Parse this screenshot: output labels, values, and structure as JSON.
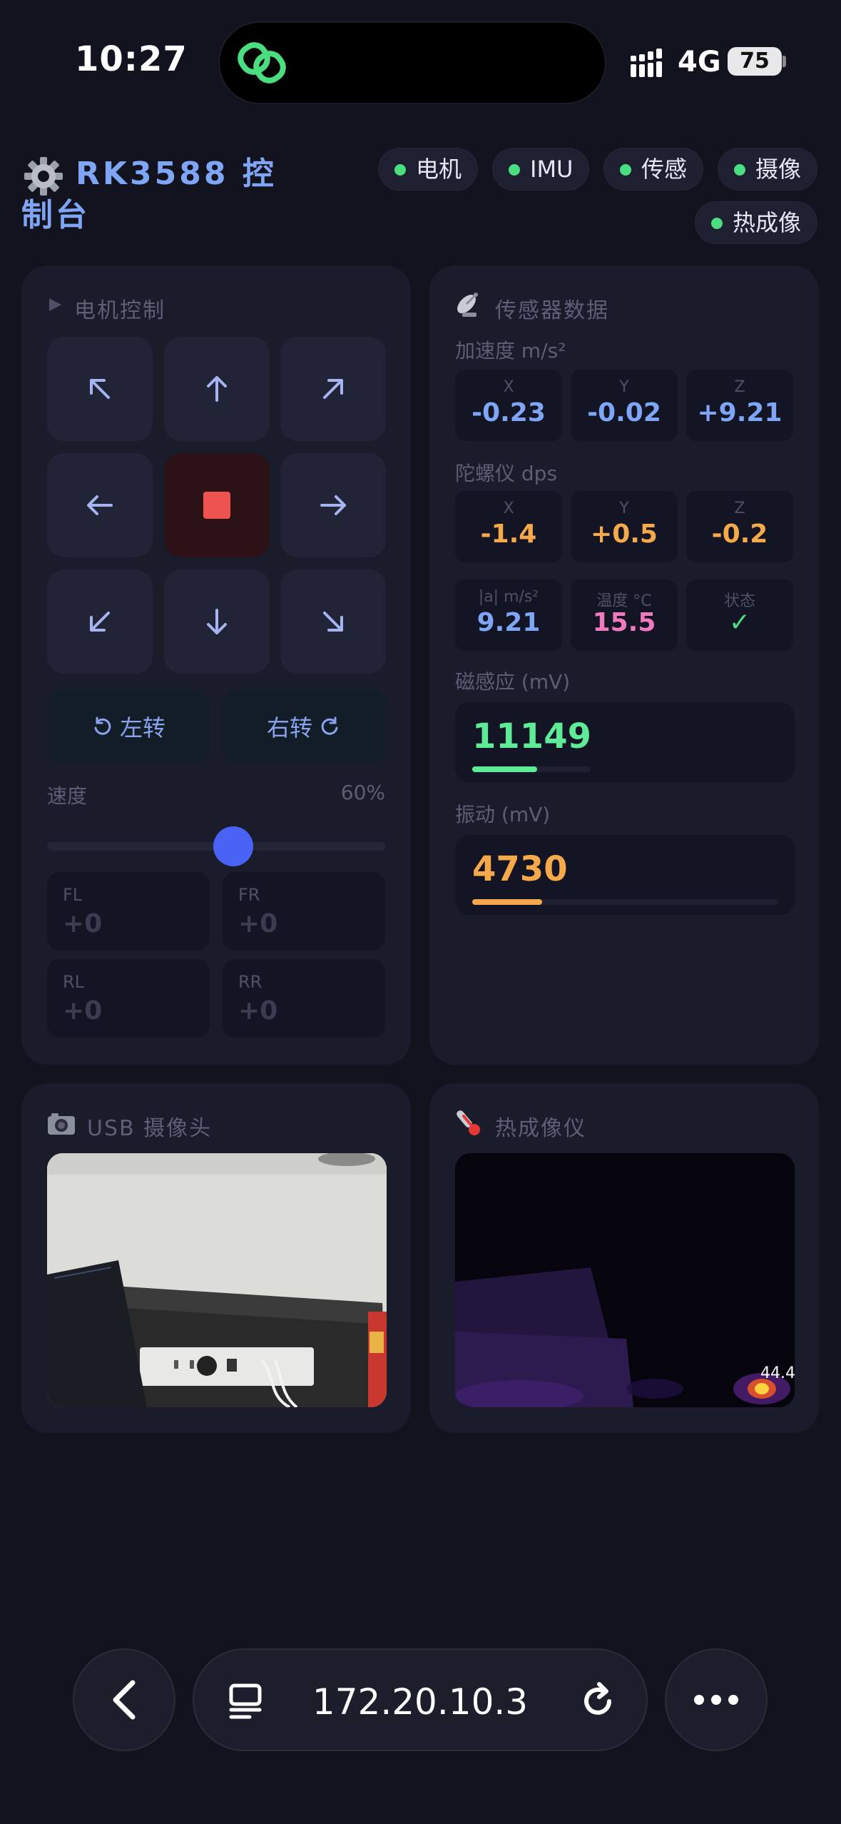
{
  "status_bar": {
    "time": "10:27",
    "network": "4G",
    "battery": "75"
  },
  "header": {
    "title": "RK3588 控制台",
    "indicators": [
      {
        "label": "电机",
        "status_color": "#4ade80"
      },
      {
        "label": "IMU",
        "status_color": "#4ade80"
      },
      {
        "label": "传感",
        "status_color": "#4ade80"
      },
      {
        "label": "摄像",
        "status_color": "#4ade80"
      },
      {
        "label": "热成像",
        "status_color": "#4ade80"
      }
    ]
  },
  "motor": {
    "title": "电机控制",
    "direction_icons": [
      "arrow-up-left",
      "arrow-up",
      "arrow-up-right",
      "arrow-left",
      "stop",
      "arrow-right",
      "arrow-down-left",
      "arrow-down",
      "arrow-down-right"
    ],
    "rotate_left": "左转",
    "rotate_right": "右转",
    "speed_label": "速度",
    "speed_value": "60%",
    "speed_level": 0.55,
    "wheels": [
      {
        "label": "FL",
        "value": "+0"
      },
      {
        "label": "FR",
        "value": "+0"
      },
      {
        "label": "RL",
        "value": "+0"
      },
      {
        "label": "RR",
        "value": "+0"
      }
    ]
  },
  "sensors": {
    "title": "传感器数据",
    "accel_label": "加速度 m/s²",
    "accel": [
      {
        "axis": "X",
        "value": "-0.23"
      },
      {
        "axis": "Y",
        "value": "-0.02"
      },
      {
        "axis": "Z",
        "value": "+9.21"
      }
    ],
    "gyro_label": "陀螺仪 dps",
    "gyro": [
      {
        "axis": "X",
        "value": "-1.4"
      },
      {
        "axis": "Y",
        "value": "+0.5"
      },
      {
        "axis": "Z",
        "value": "-0.2"
      }
    ],
    "extra": [
      {
        "label": "|a| m/s²",
        "value": "9.21"
      },
      {
        "label": "温度 °C",
        "value": "15.5"
      },
      {
        "label": "状态",
        "value": "✓"
      }
    ],
    "magnetic_label": "磁感应 (mV)",
    "magnetic_value": "11149",
    "magnetic_level": 0.55,
    "vibration_label": "振动 (mV)",
    "vibration_value": "4730",
    "vibration_level": 0.23,
    "colors": {
      "accel": "#7fa6f5",
      "gyro": "#f5a94a",
      "magnitude": "#7fa6f5",
      "temperature": "#f07ac0",
      "status": "#4ade80",
      "magnetic": "#5eea96",
      "vibration": "#f5a94a"
    }
  },
  "usb_camera": {
    "title": "USB 摄像头"
  },
  "thermal": {
    "title": "热成像仪",
    "overlay_value": "44.4"
  },
  "browser": {
    "url": "172.20.10.3"
  }
}
